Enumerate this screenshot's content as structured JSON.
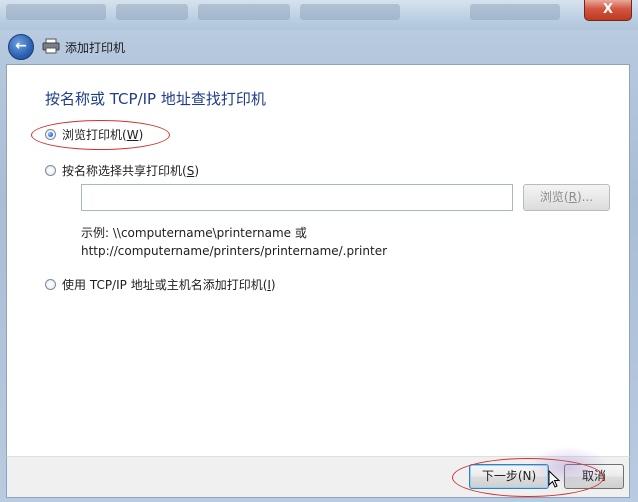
{
  "window": {
    "close_glyph": "X",
    "title": "添加打印机"
  },
  "nav": {
    "back_icon": "back-arrow-icon",
    "printer_icon": "printer-icon"
  },
  "main": {
    "heading": "按名称或 TCP/IP 地址查找打印机",
    "options": [
      {
        "label": "浏览打印机(",
        "key": "W",
        "label_end": ")",
        "checked": true
      },
      {
        "label": "按名称选择共享打印机(",
        "key": "S",
        "label_end": ")",
        "checked": false
      },
      {
        "label": "使用 TCP/IP 地址或主机名添加打印机(",
        "key": "I",
        "label_end": ")",
        "checked": false
      }
    ],
    "share_input": {
      "value": "",
      "placeholder": ""
    },
    "browse_button": {
      "label": "浏览(",
      "key": "R",
      "label_end": ")..."
    },
    "example_line1": "示例: \\\\computername\\printername 或",
    "example_line2": "http://computername/printers/printername/.printer"
  },
  "footer": {
    "next_label": "下一步(N)",
    "cancel_label": "取消"
  },
  "colors": {
    "heading": "#1f3d8a",
    "annotation": "#d0322e",
    "close": "#c0381f"
  }
}
